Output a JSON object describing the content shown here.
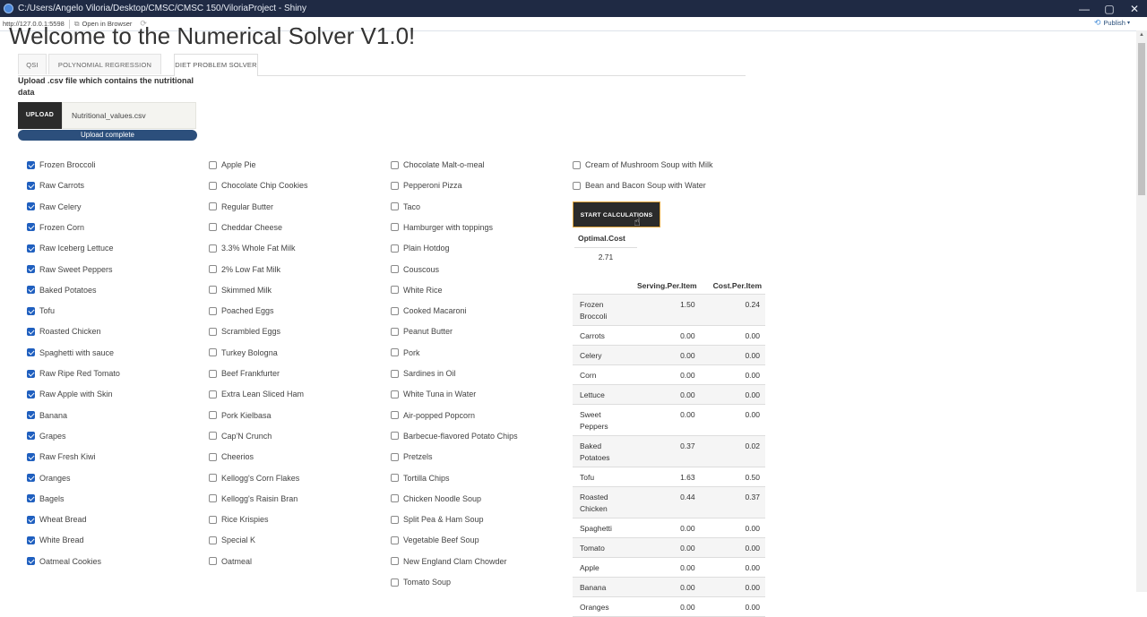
{
  "window": {
    "title": "C:/Users/Angelo Viloria/Desktop/CMSC/CMSC 150/ViloriaProject - Shiny",
    "controls": {
      "minimize": "—",
      "maximize": "▢",
      "close": "✕"
    }
  },
  "toolbar": {
    "url": "http://127.0.0.1:5598",
    "open_in_browser": "Open in Browser",
    "publish": "Publish"
  },
  "page": {
    "title": "Welcome to the Numerical Solver V1.0!"
  },
  "tabs": [
    {
      "label": "QSI",
      "active": false
    },
    {
      "label": "POLYNOMIAL REGRESSION",
      "active": false
    },
    {
      "label": "DIET PROBLEM SOLVER",
      "active": true
    }
  ],
  "upload": {
    "label": "Upload .csv file which contains the nutritional data",
    "button": "UPLOAD",
    "file_name": "Nutritional_values.csv",
    "progress_text": "Upload complete",
    "progress": 1.0
  },
  "foods": {
    "col1": [
      {
        "label": "Frozen Broccoli",
        "checked": true
      },
      {
        "label": "Raw Carrots",
        "checked": true
      },
      {
        "label": "Raw Celery",
        "checked": true
      },
      {
        "label": "Frozen Corn",
        "checked": true
      },
      {
        "label": "Raw Iceberg Lettuce",
        "checked": true
      },
      {
        "label": "Raw Sweet Peppers",
        "checked": true
      },
      {
        "label": "Baked Potatoes",
        "checked": true
      },
      {
        "label": "Tofu",
        "checked": true
      },
      {
        "label": "Roasted Chicken",
        "checked": true
      },
      {
        "label": "Spaghetti with sauce",
        "checked": true
      },
      {
        "label": "Raw Ripe Red Tomato",
        "checked": true
      },
      {
        "label": "Raw Apple with Skin",
        "checked": true
      },
      {
        "label": "Banana",
        "checked": true
      },
      {
        "label": "Grapes",
        "checked": true
      },
      {
        "label": "Raw Fresh Kiwi",
        "checked": true
      },
      {
        "label": "Oranges",
        "checked": true
      },
      {
        "label": "Bagels",
        "checked": true
      },
      {
        "label": "Wheat Bread",
        "checked": true
      },
      {
        "label": "White Bread",
        "checked": true
      },
      {
        "label": "Oatmeal Cookies",
        "checked": true
      }
    ],
    "col2": [
      {
        "label": "Apple Pie",
        "checked": false
      },
      {
        "label": "Chocolate Chip Cookies",
        "checked": false
      },
      {
        "label": "Regular Butter",
        "checked": false
      },
      {
        "label": "Cheddar Cheese",
        "checked": false
      },
      {
        "label": "3.3% Whole Fat Milk",
        "checked": false
      },
      {
        "label": "2% Low Fat Milk",
        "checked": false
      },
      {
        "label": "Skimmed Milk",
        "checked": false
      },
      {
        "label": "Poached Eggs",
        "checked": false
      },
      {
        "label": "Scrambled Eggs",
        "checked": false
      },
      {
        "label": "Turkey Bologna",
        "checked": false
      },
      {
        "label": "Beef Frankfurter",
        "checked": false
      },
      {
        "label": "Extra Lean Sliced Ham",
        "checked": false
      },
      {
        "label": "Pork Kielbasa",
        "checked": false
      },
      {
        "label": "Cap'N Crunch",
        "checked": false
      },
      {
        "label": "Cheerios",
        "checked": false
      },
      {
        "label": "Kellogg's Corn Flakes",
        "checked": false
      },
      {
        "label": "Kellogg's Raisin Bran",
        "checked": false
      },
      {
        "label": "Rice Krispies",
        "checked": false
      },
      {
        "label": "Special K",
        "checked": false
      },
      {
        "label": "Oatmeal",
        "checked": false
      }
    ],
    "col3": [
      {
        "label": "Chocolate Malt-o-meal",
        "checked": false
      },
      {
        "label": "Pepperoni Pizza",
        "checked": false
      },
      {
        "label": "Taco",
        "checked": false
      },
      {
        "label": "Hamburger with toppings",
        "checked": false
      },
      {
        "label": "Plain Hotdog",
        "checked": false
      },
      {
        "label": "Couscous",
        "checked": false
      },
      {
        "label": "White Rice",
        "checked": false
      },
      {
        "label": "Cooked Macaroni",
        "checked": false
      },
      {
        "label": "Peanut Butter",
        "checked": false
      },
      {
        "label": "Pork",
        "checked": false
      },
      {
        "label": "Sardines in Oil",
        "checked": false
      },
      {
        "label": "White Tuna in Water",
        "checked": false
      },
      {
        "label": "Air-popped Popcorn",
        "checked": false
      },
      {
        "label": "Barbecue-flavored Potato Chips",
        "checked": false
      },
      {
        "label": "Pretzels",
        "checked": false
      },
      {
        "label": "Tortilla Chips",
        "checked": false
      },
      {
        "label": "Chicken Noodle Soup",
        "checked": false
      },
      {
        "label": "Split Pea & Ham Soup",
        "checked": false
      },
      {
        "label": "Vegetable Beef Soup",
        "checked": false
      },
      {
        "label": "New England Clam Chowder",
        "checked": false
      },
      {
        "label": "Tomato Soup",
        "checked": false
      }
    ],
    "col4": [
      {
        "label": "Cream of Mushroom Soup with Milk",
        "checked": false
      },
      {
        "label": "Bean and Bacon Soup with Water",
        "checked": false
      }
    ]
  },
  "calc_button": "START CALCULATIONS",
  "optimal": {
    "header": "Optimal.Cost",
    "value": "2.71"
  },
  "results": {
    "headers": [
      "",
      "Serving.Per.Item",
      "Cost.Per.Item"
    ],
    "rows": [
      [
        "Frozen Broccoli",
        "1.50",
        "0.24"
      ],
      [
        "Carrots",
        "0.00",
        "0.00"
      ],
      [
        "Celery",
        "0.00",
        "0.00"
      ],
      [
        "Corn",
        "0.00",
        "0.00"
      ],
      [
        "Lettuce",
        "0.00",
        "0.00"
      ],
      [
        "Sweet Peppers",
        "0.00",
        "0.00"
      ],
      [
        "Baked Potatoes",
        "0.37",
        "0.02"
      ],
      [
        "Tofu",
        "1.63",
        "0.50"
      ],
      [
        "Roasted Chicken",
        "0.44",
        "0.37"
      ],
      [
        "Spaghetti",
        "0.00",
        "0.00"
      ],
      [
        "Tomato",
        "0.00",
        "0.00"
      ],
      [
        "Apple",
        "0.00",
        "0.00"
      ],
      [
        "Banana",
        "0.00",
        "0.00"
      ],
      [
        "Oranges",
        "0.00",
        "0.00"
      ]
    ]
  }
}
